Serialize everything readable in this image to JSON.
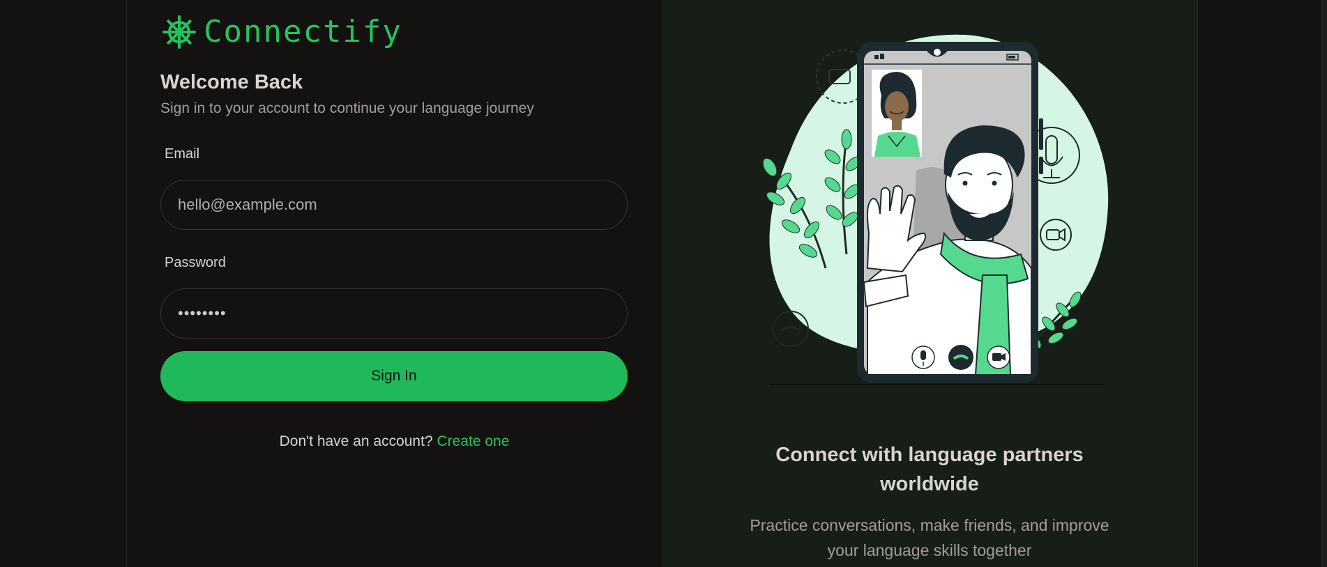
{
  "brand": {
    "name": "Connectify",
    "icon": "ship-wheel-icon",
    "color": "#23c45e"
  },
  "login": {
    "title": "Welcome Back",
    "subtitle": "Sign in to your account to continue your language journey",
    "email_label": "Email",
    "email_placeholder": "hello@example.com",
    "email_value": "",
    "password_label": "Password",
    "password_value": "••••••••",
    "submit_label": "Sign In",
    "signup_prompt": "Don't have an account?",
    "signup_link": "Create one"
  },
  "hero": {
    "title_line1": "Connect with language partners",
    "title_line2": "worldwide",
    "desc_line1": "Practice conversations, make friends, and improve",
    "desc_line2": "your language skills together",
    "accent_color": "#55d98f",
    "blob_color": "#d5f6e4"
  }
}
